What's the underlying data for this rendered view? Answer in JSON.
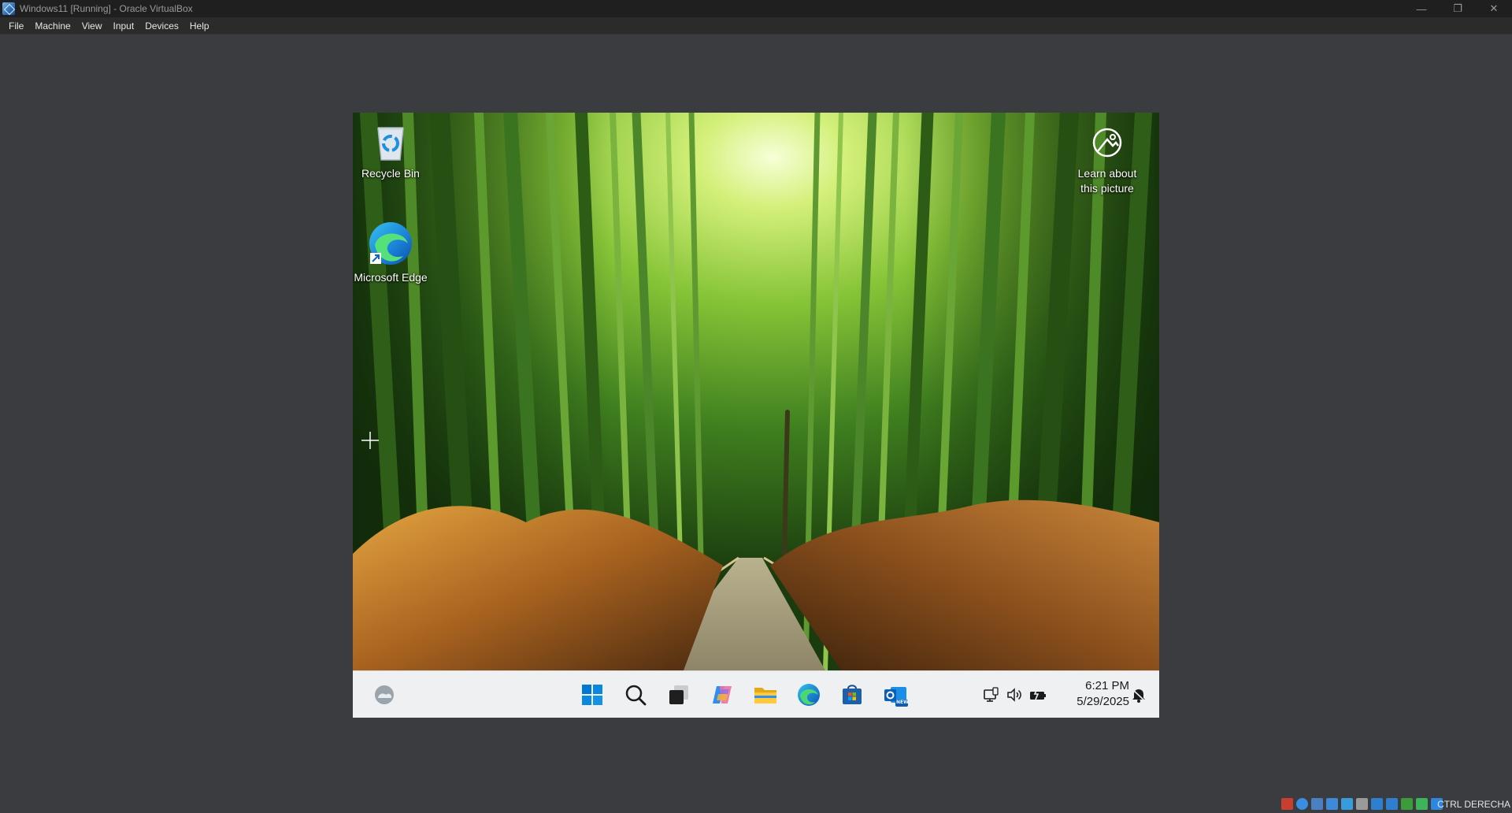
{
  "window": {
    "title": "Windows11 [Running] - Oracle VirtualBox",
    "controls": {
      "minimize": "—",
      "restore": "❐",
      "close": "✕"
    }
  },
  "menu": {
    "items": [
      {
        "label": "File"
      },
      {
        "label": "Machine"
      },
      {
        "label": "View"
      },
      {
        "label": "Input"
      },
      {
        "label": "Devices"
      },
      {
        "label": "Help"
      }
    ]
  },
  "desktop": {
    "icons": [
      {
        "label": "Recycle Bin",
        "icon": "recycle-bin-icon"
      },
      {
        "label": "Microsoft Edge",
        "icon": "edge-shortcut-icon"
      },
      {
        "label": "Learn about this picture",
        "icon": "learn-picture-icon"
      }
    ]
  },
  "taskbar": {
    "pinned": [
      {
        "name": "widgets-weather-icon"
      },
      {
        "name": "start-icon"
      },
      {
        "name": "search-icon"
      },
      {
        "name": "task-view-icon"
      },
      {
        "name": "copilot-icon"
      },
      {
        "name": "file-explorer-icon"
      },
      {
        "name": "edge-icon"
      },
      {
        "name": "microsoft-store-icon"
      },
      {
        "name": "outlook-new-icon"
      }
    ],
    "outlook_badge": "NEW",
    "tray": [
      "network-icon",
      "volume-icon",
      "battery-icon",
      "notification-bell-icon"
    ],
    "time": "6:21 PM",
    "date": "5/29/2025"
  },
  "statusbar": {
    "host_key": "CTRL DERECHA",
    "icons": [
      "hard-disk-icon",
      "optical-drive-icon",
      "audio-icon",
      "network-adapter-icon",
      "usb-icon",
      "shared-folders-icon",
      "display-icon",
      "recording-icon",
      "cpu-icon",
      "mouse-integration-icon",
      "keyboard-capture-icon"
    ]
  },
  "colors": {
    "host_background": "#3b3c3f",
    "titlebar": "#1f1f1f",
    "menubar": "#2b2b2b",
    "taskbar": "#eef0f2",
    "windows_blue": "#0078d4"
  }
}
